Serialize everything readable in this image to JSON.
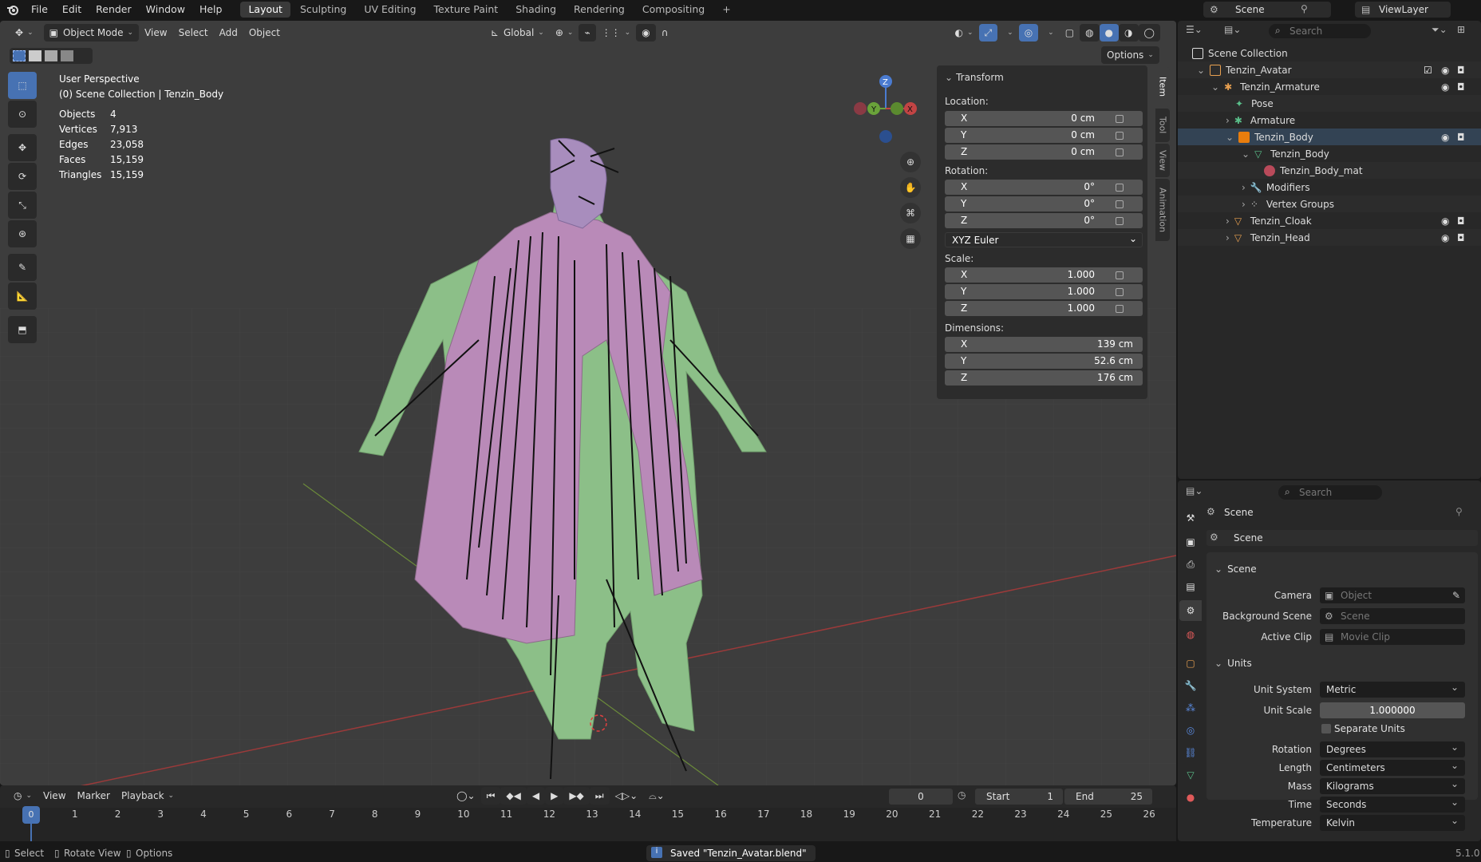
{
  "menubar": {
    "items": [
      "File",
      "Edit",
      "Render",
      "Window",
      "Help"
    ],
    "workspaces": [
      "Layout",
      "Sculpting",
      "UV Editing",
      "Texture Paint",
      "Shading",
      "Rendering",
      "Compositing"
    ],
    "active_workspace": "Layout",
    "scene": "Scene",
    "view_layer": "ViewLayer"
  },
  "viewport_header": {
    "mode": "Object Mode",
    "menus": [
      "View",
      "Select",
      "Add",
      "Object"
    ],
    "orientation": "Global",
    "options": "Options"
  },
  "viewport": {
    "perspective": "User Perspective",
    "collection": "(0) Scene Collection | Tenzin_Body",
    "stats": [
      {
        "label": "Objects",
        "value": "4"
      },
      {
        "label": "Vertices",
        "value": "7,913"
      },
      {
        "label": "Edges",
        "value": "23,058"
      },
      {
        "label": "Faces",
        "value": "15,159"
      },
      {
        "label": "Triangles",
        "value": "15,159"
      }
    ],
    "gizmo": {
      "z": "Z",
      "y": "Y",
      "x": "X"
    }
  },
  "npanel": {
    "title": "Transform",
    "location_label": "Location:",
    "location": [
      {
        "axis": "X",
        "value": "0 cm"
      },
      {
        "axis": "Y",
        "value": "0 cm"
      },
      {
        "axis": "Z",
        "value": "0 cm"
      }
    ],
    "rotation_label": "Rotation:",
    "rotation": [
      {
        "axis": "X",
        "value": "0°"
      },
      {
        "axis": "Y",
        "value": "0°"
      },
      {
        "axis": "Z",
        "value": "0°"
      }
    ],
    "rotation_mode": "XYZ Euler",
    "scale_label": "Scale:",
    "scale": [
      {
        "axis": "X",
        "value": "1.000"
      },
      {
        "axis": "Y",
        "value": "1.000"
      },
      {
        "axis": "Z",
        "value": "1.000"
      }
    ],
    "dimensions_label": "Dimensions:",
    "dimensions": [
      {
        "axis": "X",
        "value": "139 cm"
      },
      {
        "axis": "Y",
        "value": "52.6 cm"
      },
      {
        "axis": "Z",
        "value": "176 cm"
      }
    ],
    "tabs": [
      "Item",
      "Tool",
      "View",
      "Animation"
    ]
  },
  "outliner": {
    "search_placeholder": "Search",
    "rows": [
      {
        "label": "Scene Collection"
      },
      {
        "label": "Tenzin_Avatar"
      },
      {
        "label": "Tenzin_Armature"
      },
      {
        "label": "Pose"
      },
      {
        "label": "Armature"
      },
      {
        "label": "Tenzin_Body"
      },
      {
        "label": "Tenzin_Body"
      },
      {
        "label": "Tenzin_Body_mat"
      },
      {
        "label": "Modifiers"
      },
      {
        "label": "Vertex Groups"
      },
      {
        "label": "Tenzin_Cloak"
      },
      {
        "label": "Tenzin_Head"
      }
    ]
  },
  "properties": {
    "search_placeholder": "Search",
    "context": "Scene",
    "datablock": "Scene",
    "scene_section": "Scene",
    "camera_label": "Camera",
    "camera_placeholder": "Object",
    "background_label": "Background Scene",
    "background_placeholder": "Scene",
    "clip_label": "Active Clip",
    "clip_placeholder": "Movie Clip",
    "units_section": "Units",
    "unit_system_label": "Unit System",
    "unit_system": "Metric",
    "unit_scale_label": "Unit Scale",
    "unit_scale": "1.000000",
    "separate_units": "Separate Units",
    "rotation_label": "Rotation",
    "rotation": "Degrees",
    "length_label": "Length",
    "length": "Centimeters",
    "mass_label": "Mass",
    "mass": "Kilograms",
    "time_label": "Time",
    "time": "Seconds",
    "temperature_label": "Temperature",
    "temperature": "Kelvin"
  },
  "timeline": {
    "menus": [
      "View",
      "Marker",
      "Playback"
    ],
    "current_frame": "0",
    "start_label": "Start",
    "start": "1",
    "end_label": "End",
    "end": "25",
    "ticks": [
      "0",
      "1",
      "2",
      "3",
      "4",
      "5",
      "6",
      "7",
      "8",
      "9",
      "10",
      "11",
      "12",
      "13",
      "14",
      "15",
      "16",
      "17",
      "18",
      "19",
      "20",
      "21",
      "22",
      "23",
      "24",
      "25",
      "26"
    ]
  },
  "statusbar": {
    "select": "Select",
    "rotate": "Rotate View",
    "options": "Options",
    "message": "Saved \"Tenzin_Avatar.blend\"",
    "version": "5.1.0"
  },
  "colors": {
    "accent": "#4772b3",
    "body": "#8cbf88",
    "cloak": "#b98ab8",
    "selected_orange": "#e87d0d"
  }
}
